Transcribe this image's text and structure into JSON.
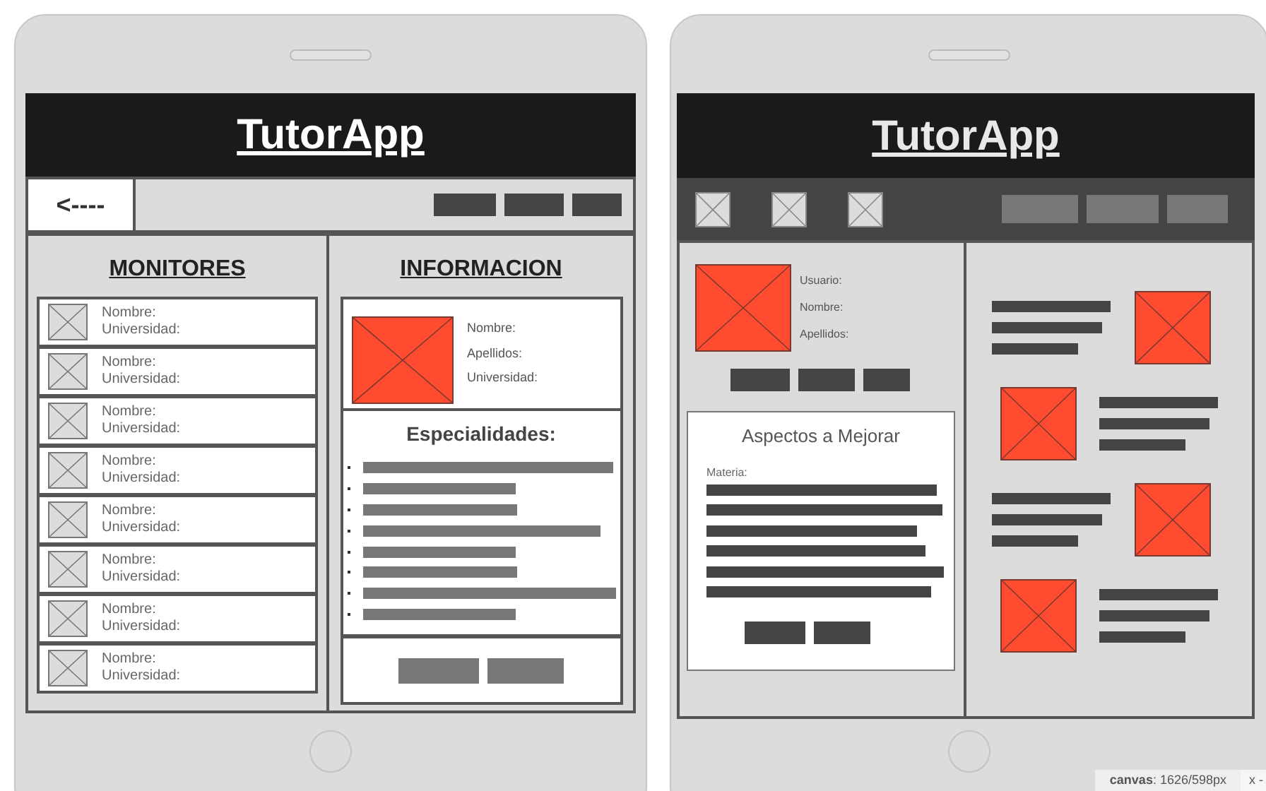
{
  "left_tablet": {
    "title": "TutorApp",
    "back_label": "<----",
    "list_title": "MONITORES",
    "monitors": [
      {
        "name_label": "Nombre:",
        "university_label": "Universidad:"
      },
      {
        "name_label": "Nombre:",
        "university_label": "Universidad:"
      },
      {
        "name_label": "Nombre:",
        "university_label": "Universidad:"
      },
      {
        "name_label": "Nombre:",
        "university_label": "Universidad:"
      },
      {
        "name_label": "Nombre:",
        "university_label": "Universidad:"
      },
      {
        "name_label": "Nombre:",
        "university_label": "Universidad:"
      },
      {
        "name_label": "Nombre:",
        "university_label": "Universidad:"
      },
      {
        "name_label": "Nombre:",
        "university_label": "Universidad:"
      }
    ],
    "info_title": "INFORMACION",
    "info_fields": [
      "Nombre:",
      "Apellidos:",
      "Universidad:"
    ],
    "specialties_title": "Especialidades:"
  },
  "right_tablet": {
    "title": "TutorApp",
    "profile_fields": [
      "Usuario:",
      "Nombre:",
      "Apellidos:"
    ],
    "card_title": "Aspectos a Mejorar",
    "card_field": "Materia:"
  },
  "status_bar": {
    "canvas": "**canvas**: 1626/598px",
    "close": "x -"
  }
}
